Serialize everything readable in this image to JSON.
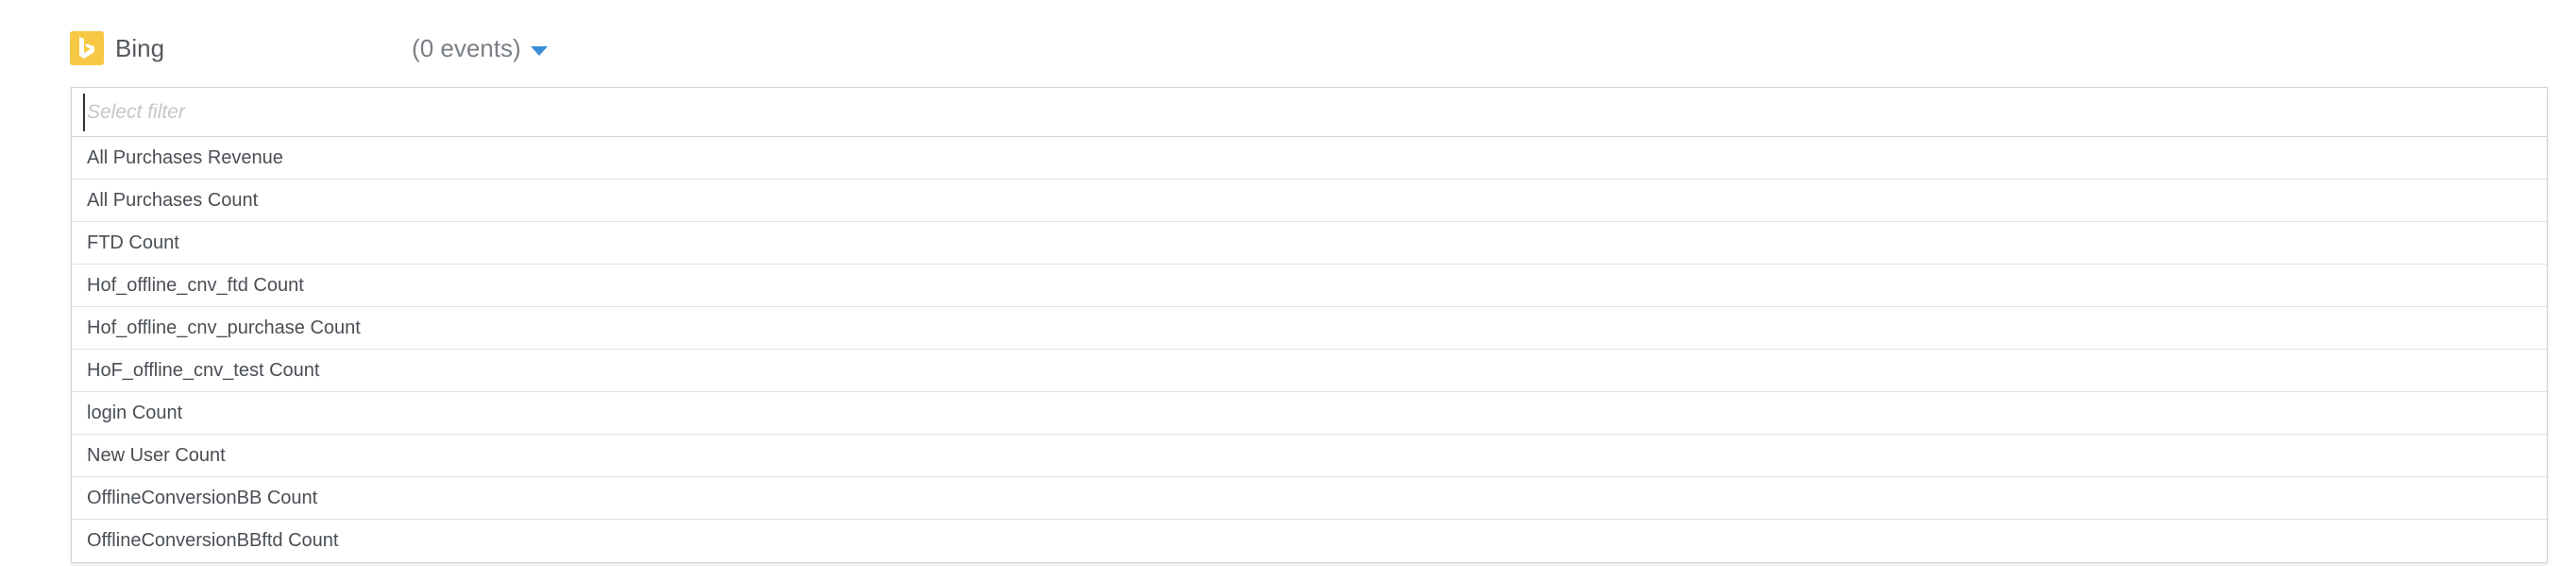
{
  "header": {
    "source_name": "Bing",
    "account_name": ",           _",
    "events_count": "(0 events)",
    "logo_color": "#f7c843"
  },
  "filter": {
    "placeholder": "Select filter",
    "value": ""
  },
  "options": [
    "All Purchases Revenue",
    "All Purchases Count",
    "FTD Count",
    "Hof_offline_cnv_ftd Count",
    "Hof_offline_cnv_purchase Count",
    "HoF_offline_cnv_test Count",
    "login Count",
    "New User Count",
    "OfflineConversionBB Count",
    "OfflineConversionBBftd Count"
  ],
  "colors": {
    "accent": "#3b8ed8",
    "border": "#cfd3d7",
    "text": "#4a4f55"
  }
}
